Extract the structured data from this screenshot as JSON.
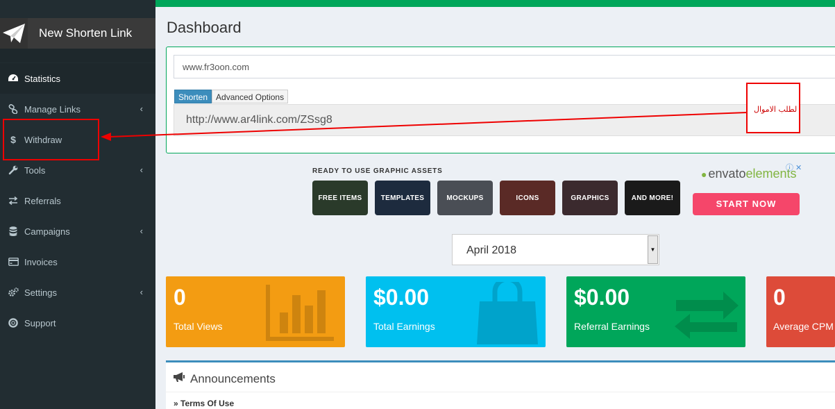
{
  "app": {
    "name": "New Shorten Link"
  },
  "sidebar": {
    "items": [
      {
        "label": "Statistics",
        "icon": "dashboard-icon",
        "active": true,
        "has_submenu": false
      },
      {
        "label": "Manage Links",
        "icon": "link-icon",
        "active": false,
        "has_submenu": true
      },
      {
        "label": "Withdraw",
        "icon": "dollar-icon",
        "active": false,
        "has_submenu": false
      },
      {
        "label": "Tools",
        "icon": "wrench-icon",
        "active": false,
        "has_submenu": true
      },
      {
        "label": "Referrals",
        "icon": "exchange-icon",
        "active": false,
        "has_submenu": false
      },
      {
        "label": "Campaigns",
        "icon": "database-icon",
        "active": false,
        "has_submenu": true
      },
      {
        "label": "Invoices",
        "icon": "credit-card-icon",
        "active": false,
        "has_submenu": false
      },
      {
        "label": "Settings",
        "icon": "cogs-icon",
        "active": false,
        "has_submenu": true
      },
      {
        "label": "Support",
        "icon": "life-ring-icon",
        "active": false,
        "has_submenu": false
      }
    ]
  },
  "page": {
    "title": "Dashboard"
  },
  "shorten": {
    "url_value": "www.fr3oon.com",
    "tabs": [
      {
        "label": "Shorten",
        "active": true
      },
      {
        "label": "Advanced Options",
        "active": false
      }
    ],
    "result": "http://www.ar4link.com/ZSsg8"
  },
  "annotation": {
    "text": "لطلب الاموال"
  },
  "ad": {
    "heading": "READY TO USE GRAPHIC ASSETS",
    "tiles": [
      {
        "label": "FREE ITEMS",
        "color": "#2a3a2a"
      },
      {
        "label": "TEMPLATES",
        "color": "#1d2b3e"
      },
      {
        "label": "MOCKUPS",
        "color": "#4a4e55"
      },
      {
        "label": "ICONS",
        "color": "#5a2a26"
      },
      {
        "label": "GRAPHICS",
        "color": "#3b2a2e"
      },
      {
        "label": "AND MORE!",
        "color": "#1a1a1a"
      }
    ],
    "brand_prefix": "envato",
    "brand_suffix": "elements",
    "cta": "START NOW",
    "close_label": "ⓘ ✕"
  },
  "month": {
    "selected": "April 2018"
  },
  "stats": [
    {
      "value": "0",
      "label": "Total Views",
      "color": "#f39c12",
      "icon": "bar-chart-icon"
    },
    {
      "value": "$0.00",
      "label": "Total Earnings",
      "color": "#00c0ef",
      "icon": "shopping-bag-icon"
    },
    {
      "value": "$0.00",
      "label": "Referral Earnings",
      "color": "#00a65a",
      "icon": "exchange-icon"
    },
    {
      "value": "0",
      "label": "Average CPM",
      "color": "#dd4b39",
      "icon": "none"
    }
  ],
  "announcements": {
    "title": "Announcements",
    "items": [
      "» Terms Of Use"
    ]
  },
  "colors": {
    "sidebar_bg": "#222d32",
    "accent_green": "#00a65a",
    "primary_blue": "#3c8dbc",
    "highlight_red": "#ee0000"
  }
}
